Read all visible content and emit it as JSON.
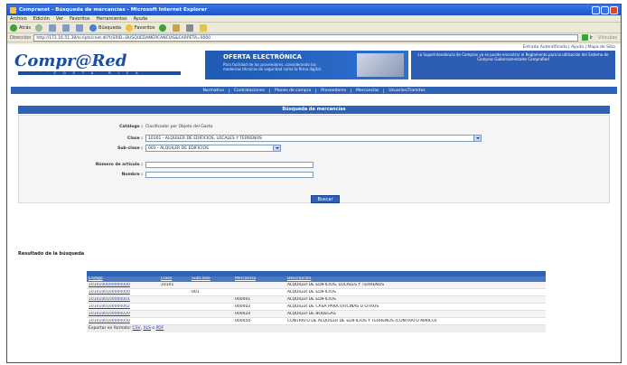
{
  "window": {
    "title": "Compranet - Búsqueda de mercancías - Microsoft Internet Explorer"
  },
  "menu": [
    "Archivo",
    "Edición",
    "Ver",
    "Favoritos",
    "Herramientas",
    "Ayuda"
  ],
  "toolbar": {
    "back_label": "Atrás",
    "search_label": "Búsqueda",
    "favorites_label": "Favoritos"
  },
  "addressbar": {
    "label": "Dirección",
    "url": "http://172.16.51.38/scripts/cnet.dll?USRID=BUSQUEDAMERCANCIAS&CARPETA=0000",
    "go_label": "Ir",
    "links_label": "Vínculos"
  },
  "banner": {
    "toplinks": "Entrada Autentificada | Ayuda | Mapa de Sitio",
    "logo": "Compr@Red",
    "logo_sub": "COSTA RICA",
    "promo_title": "OFERTA ELECTRÓNICA",
    "promo_desc": "Para facilidad de los proveedores, considerando las modernas técnicas de seguridad como la firma digital.",
    "notice": "La Superintendencia de Compras ya se puede encontrar el Reglamento para la utilización del Sistema de Compras Gubernamentales CompraRed"
  },
  "nav": [
    "Normativa",
    "Contrataciones",
    "Planes de compra",
    "Proveedores",
    "Mercancías",
    "Usuarios/Tramites"
  ],
  "search": {
    "header": "Búsqueda de mercancías",
    "catalog_label": "Catálogo :",
    "catalog_value": "Clasificador por Objeto del Gasto",
    "class_label": "Clase :",
    "class_value": "10101 - ALQUILER DE EDIFICIOS, LOCALES Y TERRENOS",
    "subclass_label": "Sub-clase :",
    "subclass_value": "001 - ALQUILER DE EDIFICIOS",
    "article_number_label": "Número de artículo :",
    "name_label": "Nombre :",
    "button_label": "Buscar"
  },
  "results": {
    "title": "Resultado de la búsqueda",
    "columns": [
      "Código",
      "Clase",
      "SubClase",
      "Mercancía",
      "Descripción"
    ],
    "rows": [
      {
        "code": "1010100000000000",
        "clase": "10101",
        "subclase": "",
        "mercancia": "",
        "desc": "ALQUILER DE EDIFICIOS, LOCALES Y TERRENOS"
      },
      {
        "code": "1010100100000000",
        "clase": "",
        "subclase": "001",
        "mercancia": "",
        "desc": "ALQUILER DE EDIFICIOS"
      },
      {
        "code": "1010100100000001",
        "clase": "",
        "subclase": "",
        "mercancia": "000001",
        "desc": "ALQUILER DE EDIFICIOS"
      },
      {
        "code": "1010100100000002",
        "clase": "",
        "subclase": "",
        "mercancia": "000002",
        "desc": "ALQUILER DE CASA PARA OFICINAS U OTROS"
      },
      {
        "code": "1010100100000020",
        "clase": "",
        "subclase": "",
        "mercancia": "000020",
        "desc": "ALQUILER DE BODEGAS"
      },
      {
        "code": "1010100100000050",
        "clase": "",
        "subclase": "",
        "mercancia": "000050",
        "desc": "CONTRATO DE ALQUILER DE EDIFICIOS Y TERRENOS (CONTRATO MARCO)"
      }
    ],
    "export_label": "Exportar en formato:",
    "export_csv": "CSV",
    "export_sep1": ",",
    "export_xls": "XLS",
    "export_sep2": "o",
    "export_pdf": "PDF"
  }
}
